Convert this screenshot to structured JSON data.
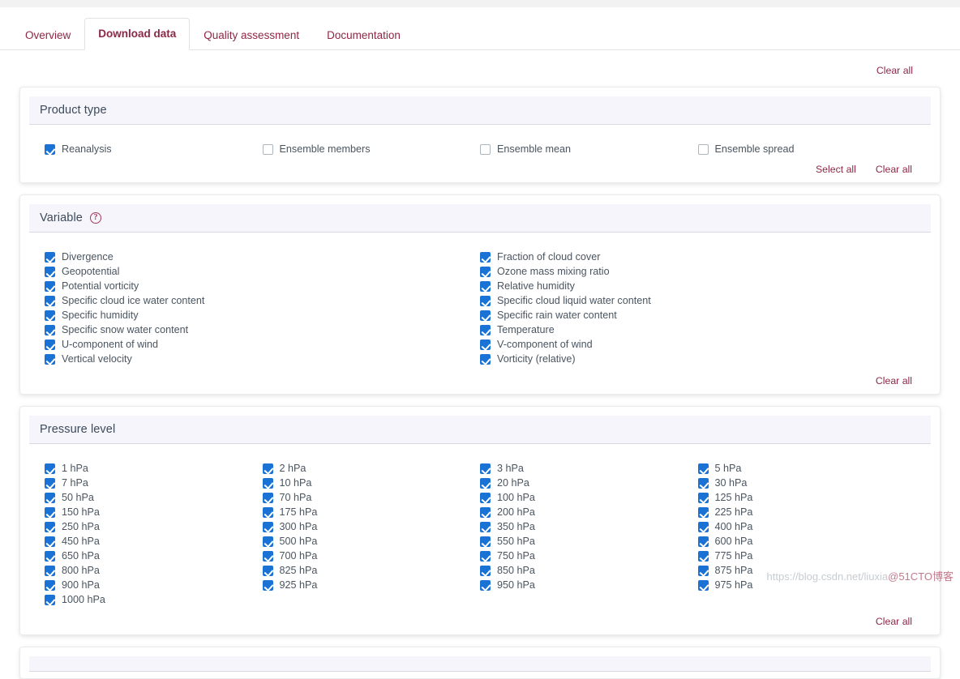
{
  "tabs": [
    {
      "label": "Overview",
      "active": false
    },
    {
      "label": "Download data",
      "active": true
    },
    {
      "label": "Quality assessment",
      "active": false
    },
    {
      "label": "Documentation",
      "active": false
    }
  ],
  "top_actions": {
    "clear_all": "Clear all"
  },
  "colors": {
    "tab_text": "#8e2746",
    "link": "#8e2746",
    "checkbox_checked": "#1a73d4",
    "section_header_bg": "#f5f5fb",
    "label_text": "#4a5560"
  },
  "sections": [
    {
      "title": "Product type",
      "help_icon": null,
      "layout": "row",
      "items": [
        {
          "label": "Reanalysis",
          "checked": true
        },
        {
          "label": "Ensemble members",
          "checked": false
        },
        {
          "label": "Ensemble mean",
          "checked": false
        },
        {
          "label": "Ensemble spread",
          "checked": false
        }
      ],
      "actions": [
        "Select all",
        "Clear all"
      ]
    },
    {
      "title": "Variable",
      "help_icon": "question-mark-circle-icon",
      "layout": "two-column",
      "columns": [
        [
          {
            "label": "Divergence",
            "checked": true
          },
          {
            "label": "Geopotential",
            "checked": true
          },
          {
            "label": "Potential vorticity",
            "checked": true
          },
          {
            "label": "Specific cloud ice water content",
            "checked": true
          },
          {
            "label": "Specific humidity",
            "checked": true
          },
          {
            "label": "Specific snow water content",
            "checked": true
          },
          {
            "label": "U-component of wind",
            "checked": true
          },
          {
            "label": "Vertical velocity",
            "checked": true
          }
        ],
        [
          {
            "label": "Fraction of cloud cover",
            "checked": true
          },
          {
            "label": "Ozone mass mixing ratio",
            "checked": true
          },
          {
            "label": "Relative humidity",
            "checked": true
          },
          {
            "label": "Specific cloud liquid water content",
            "checked": true
          },
          {
            "label": "Specific rain water content",
            "checked": true
          },
          {
            "label": "Temperature",
            "checked": true
          },
          {
            "label": "V-component of wind",
            "checked": true
          },
          {
            "label": "Vorticity (relative)",
            "checked": true
          }
        ]
      ],
      "actions": [
        "Clear all"
      ]
    },
    {
      "title": "Pressure level",
      "help_icon": null,
      "layout": "four-column",
      "columns": [
        [
          {
            "label": "1 hPa",
            "checked": true
          },
          {
            "label": "7 hPa",
            "checked": true
          },
          {
            "label": "50 hPa",
            "checked": true
          },
          {
            "label": "150 hPa",
            "checked": true
          },
          {
            "label": "250 hPa",
            "checked": true
          },
          {
            "label": "450 hPa",
            "checked": true
          },
          {
            "label": "650 hPa",
            "checked": true
          },
          {
            "label": "800 hPa",
            "checked": true
          },
          {
            "label": "900 hPa",
            "checked": true
          },
          {
            "label": "1000 hPa",
            "checked": true
          }
        ],
        [
          {
            "label": "2 hPa",
            "checked": true
          },
          {
            "label": "10 hPa",
            "checked": true
          },
          {
            "label": "70 hPa",
            "checked": true
          },
          {
            "label": "175 hPa",
            "checked": true
          },
          {
            "label": "300 hPa",
            "checked": true
          },
          {
            "label": "500 hPa",
            "checked": true
          },
          {
            "label": "700 hPa",
            "checked": true
          },
          {
            "label": "825 hPa",
            "checked": true
          },
          {
            "label": "925 hPa",
            "checked": true
          }
        ],
        [
          {
            "label": "3 hPa",
            "checked": true
          },
          {
            "label": "20 hPa",
            "checked": true
          },
          {
            "label": "100 hPa",
            "checked": true
          },
          {
            "label": "200 hPa",
            "checked": true
          },
          {
            "label": "350 hPa",
            "checked": true
          },
          {
            "label": "550 hPa",
            "checked": true
          },
          {
            "label": "750 hPa",
            "checked": true
          },
          {
            "label": "850 hPa",
            "checked": true
          },
          {
            "label": "950 hPa",
            "checked": true
          }
        ],
        [
          {
            "label": "5 hPa",
            "checked": true
          },
          {
            "label": "30 hPa",
            "checked": true
          },
          {
            "label": "125 hPa",
            "checked": true
          },
          {
            "label": "225 hPa",
            "checked": true
          },
          {
            "label": "400 hPa",
            "checked": true
          },
          {
            "label": "600 hPa",
            "checked": true
          },
          {
            "label": "775 hPa",
            "checked": true
          },
          {
            "label": "875 hPa",
            "checked": true
          },
          {
            "label": "975 hPa",
            "checked": true
          }
        ]
      ],
      "actions": [
        "Clear all"
      ]
    }
  ],
  "watermark": {
    "url": "https://blog.csdn.net/liuxia",
    "tag": "@51CTO博客"
  }
}
